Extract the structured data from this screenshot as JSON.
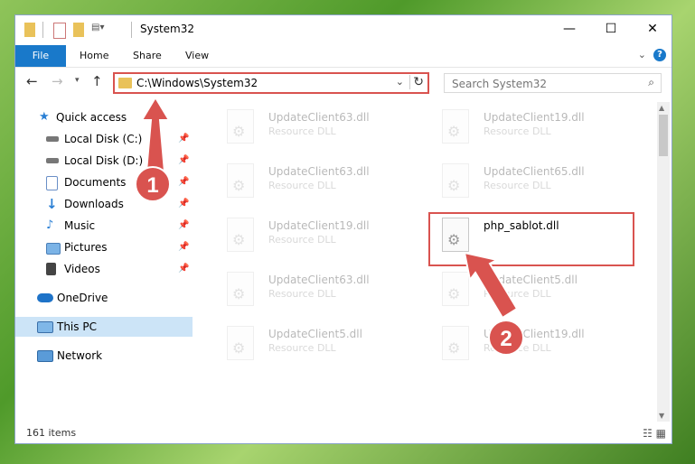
{
  "window": {
    "title": "System32",
    "controls": {
      "minimize": "—",
      "maximize": "☐",
      "close": "✕"
    }
  },
  "ribbon": {
    "tabs": [
      {
        "label": "File"
      },
      {
        "label": "Home"
      },
      {
        "label": "Share"
      },
      {
        "label": "View"
      }
    ]
  },
  "address": {
    "path": "C:\\Windows\\System32",
    "search_placeholder": "Search System32"
  },
  "sidebar": {
    "items": [
      {
        "label": "Quick access",
        "icon": "star-icon"
      },
      {
        "label": "Local Disk (C:)",
        "icon": "drive-icon"
      },
      {
        "label": "Local Disk (D:)",
        "icon": "drive-icon"
      },
      {
        "label": "Documents",
        "icon": "documents-icon"
      },
      {
        "label": "Downloads",
        "icon": "download-icon"
      },
      {
        "label": "Music",
        "icon": "music-icon"
      },
      {
        "label": "Pictures",
        "icon": "pictures-icon"
      },
      {
        "label": "Videos",
        "icon": "videos-icon"
      },
      {
        "label": "OneDrive",
        "icon": "cloud-icon"
      },
      {
        "label": "This PC",
        "icon": "computer-icon"
      },
      {
        "label": "Network",
        "icon": "network-icon"
      }
    ]
  },
  "files": [
    {
      "name": "UpdateClient63.dll",
      "type": "Resource DLL"
    },
    {
      "name": "UpdateClient19.dll",
      "type": "Resource DLL"
    },
    {
      "name": "UpdateClient63.dll",
      "type": "Resource DLL"
    },
    {
      "name": "UpdateClient65.dll",
      "type": "Resource DLL"
    },
    {
      "name": "UpdateClient19.dll",
      "type": "Resource DLL"
    },
    {
      "name": "php_sablot.dll",
      "type": ""
    },
    {
      "name": "UpdateClient63.dll",
      "type": "Resource DLL"
    },
    {
      "name": "UpdateClient5.dll",
      "type": "Resource DLL"
    },
    {
      "name": "UpdateClient5.dll",
      "type": "Resource DLL"
    },
    {
      "name": "UpdateClient19.dll",
      "type": "Resource DLL"
    }
  ],
  "status": {
    "item_count": "161 items"
  },
  "annotations": {
    "step1": "1",
    "step2": "2",
    "highlight_color": "#d9534f"
  }
}
